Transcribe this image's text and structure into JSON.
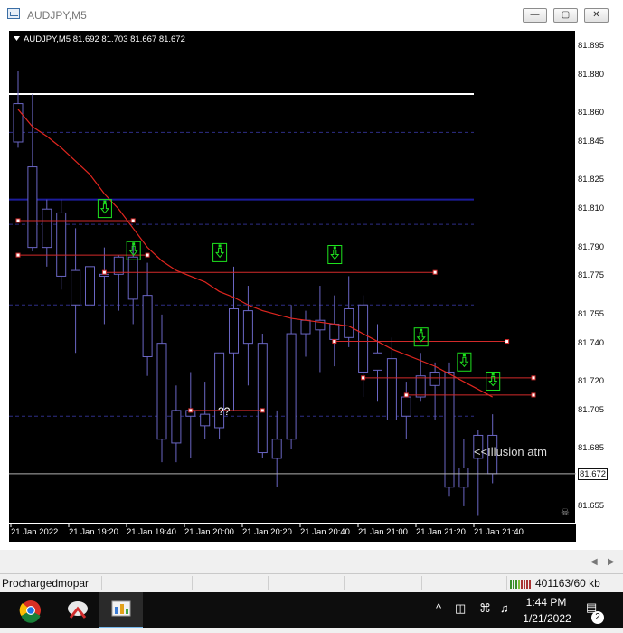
{
  "window": {
    "title": "AUDJPY,M5",
    "minimize_glyph": "—",
    "maximize_glyph": "▢",
    "close_glyph": "✕"
  },
  "chart": {
    "symbol_header": "AUDJPY,M5  81.692 81.703 81.667 81.672",
    "annotation_label": "<<Illusion atm",
    "question_label": "??",
    "current_price_label": "81.672",
    "colors": {
      "background": "#000000",
      "axis_text": "#ffffff",
      "candle_border": "#6a66c4",
      "moving_average": "#e0261f",
      "horizontal_white": "#ffffff",
      "horizontal_blue": "#1c1c9c",
      "dashed_blue": "#2e2e86",
      "level_red": "#d22a2a",
      "arrow_green": "#1ee31e"
    }
  },
  "chart_data": {
    "type": "candlestick",
    "symbol": "AUDJPY",
    "timeframe": "M5",
    "header_values": {
      "open": 81.692,
      "high": 81.703,
      "low": 81.667,
      "close": 81.672
    },
    "y_ticks": [
      81.895,
      81.88,
      81.86,
      81.845,
      81.825,
      81.81,
      81.79,
      81.775,
      81.755,
      81.74,
      81.72,
      81.705,
      81.685,
      81.672,
      81.655
    ],
    "ylim": [
      81.646,
      81.903
    ],
    "x_ticks": [
      "21 Jan 2022",
      "21 Jan 19:20",
      "21 Jan 19:40",
      "21 Jan 20:00",
      "21 Jan 20:20",
      "21 Jan 20:40",
      "21 Jan 21:00",
      "21 Jan 21:20",
      "21 Jan 21:40"
    ],
    "candles": [
      {
        "o": 81.865,
        "h": 81.882,
        "l": 81.842,
        "c": 81.845
      },
      {
        "o": 81.832,
        "h": 81.87,
        "l": 81.788,
        "c": 81.79
      },
      {
        "o": 81.79,
        "h": 81.815,
        "l": 81.78,
        "c": 81.81
      },
      {
        "o": 81.808,
        "h": 81.815,
        "l": 81.768,
        "c": 81.775
      },
      {
        "o": 81.778,
        "h": 81.8,
        "l": 81.735,
        "c": 81.76
      },
      {
        "o": 81.76,
        "h": 81.79,
        "l": 81.755,
        "c": 81.78
      },
      {
        "o": 81.776,
        "h": 81.79,
        "l": 81.75,
        "c": 81.775
      },
      {
        "o": 81.776,
        "h": 81.786,
        "l": 81.757,
        "c": 81.785
      },
      {
        "o": 81.785,
        "h": 81.792,
        "l": 81.75,
        "c": 81.763
      },
      {
        "o": 81.765,
        "h": 81.782,
        "l": 81.723,
        "c": 81.733
      },
      {
        "o": 81.74,
        "h": 81.755,
        "l": 81.678,
        "c": 81.69
      },
      {
        "o": 81.688,
        "h": 81.718,
        "l": 81.678,
        "c": 81.705
      },
      {
        "o": 81.705,
        "h": 81.725,
        "l": 81.68,
        "c": 81.702
      },
      {
        "o": 81.703,
        "h": 81.72,
        "l": 81.69,
        "c": 81.697
      },
      {
        "o": 81.696,
        "h": 81.735,
        "l": 81.69,
        "c": 81.735
      },
      {
        "o": 81.735,
        "h": 81.78,
        "l": 81.705,
        "c": 81.758
      },
      {
        "o": 81.757,
        "h": 81.77,
        "l": 81.718,
        "c": 81.74
      },
      {
        "o": 81.74,
        "h": 81.745,
        "l": 81.68,
        "c": 81.683
      },
      {
        "o": 81.68,
        "h": 81.705,
        "l": 81.665,
        "c": 81.69
      },
      {
        "o": 81.69,
        "h": 81.76,
        "l": 81.685,
        "c": 81.745
      },
      {
        "o": 81.745,
        "h": 81.757,
        "l": 81.733,
        "c": 81.752
      },
      {
        "o": 81.747,
        "h": 81.77,
        "l": 81.725,
        "c": 81.752
      },
      {
        "o": 81.75,
        "h": 81.765,
        "l": 81.728,
        "c": 81.742
      },
      {
        "o": 81.743,
        "h": 81.775,
        "l": 81.738,
        "c": 81.758
      },
      {
        "o": 81.76,
        "h": 81.765,
        "l": 81.712,
        "c": 81.725
      },
      {
        "o": 81.726,
        "h": 81.75,
        "l": 81.71,
        "c": 81.735
      },
      {
        "o": 81.732,
        "h": 81.743,
        "l": 81.7,
        "c": 81.7
      },
      {
        "o": 81.702,
        "h": 81.72,
        "l": 81.69,
        "c": 81.712
      },
      {
        "o": 81.712,
        "h": 81.735,
        "l": 81.71,
        "c": 81.723
      },
      {
        "o": 81.718,
        "h": 81.73,
        "l": 81.7,
        "c": 81.725
      },
      {
        "o": 81.725,
        "h": 81.73,
        "l": 81.66,
        "c": 81.665
      },
      {
        "o": 81.665,
        "h": 81.69,
        "l": 81.655,
        "c": 81.675
      },
      {
        "o": 81.68,
        "h": 81.695,
        "l": 81.65,
        "c": 81.692
      },
      {
        "o": 81.692,
        "h": 81.703,
        "l": 81.667,
        "c": 81.672
      }
    ],
    "moving_average": [
      81.862,
      81.853,
      81.848,
      81.842,
      81.835,
      81.828,
      81.818,
      81.81,
      81.8,
      81.79,
      81.783,
      81.778,
      81.775,
      81.772,
      81.767,
      81.764,
      81.76,
      81.757,
      81.755,
      81.753,
      81.752,
      81.751,
      81.75,
      81.749,
      81.745,
      81.741,
      81.737,
      81.734,
      81.731,
      81.728,
      81.724,
      81.72,
      81.716,
      81.712
    ],
    "horizontal_lines": [
      {
        "price": 81.87,
        "style": "white-solid"
      },
      {
        "price": 81.815,
        "style": "blue-solid"
      },
      {
        "price": 81.85,
        "style": "blue-dashed"
      },
      {
        "price": 81.802,
        "style": "blue-dashed"
      },
      {
        "price": 81.76,
        "style": "blue-dashed"
      },
      {
        "price": 81.702,
        "style": "blue-dashed"
      }
    ],
    "level_segments": [
      {
        "price": 81.804,
        "from": 0,
        "to": 8
      },
      {
        "price": 81.786,
        "from": 0,
        "to": 9
      },
      {
        "price": 81.777,
        "from": 6,
        "to": 29
      },
      {
        "price": 81.741,
        "from": 22,
        "to": 34
      },
      {
        "price": 81.722,
        "from": 24,
        "to": 36
      },
      {
        "price": 81.713,
        "from": 27,
        "to": 36
      },
      {
        "price": 81.705,
        "from": 12,
        "to": 17
      }
    ],
    "arrow_markers": [
      {
        "index": 6,
        "price": 81.815
      },
      {
        "index": 8,
        "price": 81.793
      },
      {
        "index": 14,
        "price": 81.792
      },
      {
        "index": 22,
        "price": 81.791
      },
      {
        "index": 28,
        "price": 81.748
      },
      {
        "index": 31,
        "price": 81.735
      },
      {
        "index": 33,
        "price": 81.725
      }
    ]
  },
  "status": {
    "profile": "Prochargedmopar",
    "traffic": "401163/60 kb"
  },
  "taskbar": {
    "time": "1:44 PM",
    "date": "1/21/2022",
    "notifications": "2",
    "tray_chevron": "^"
  }
}
